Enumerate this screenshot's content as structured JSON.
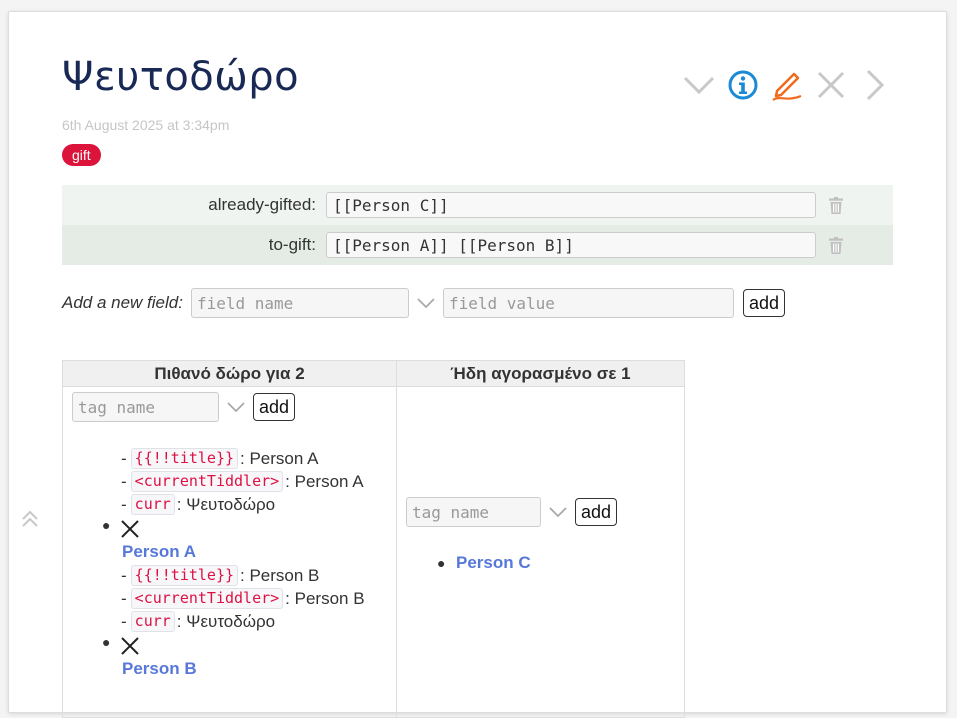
{
  "tiddler": {
    "title": "Ψευτοδώρο",
    "subtitle": "6th August 2025 at 3:34pm",
    "tag": "gift"
  },
  "toolbar": {
    "icons": [
      "chevron-down-icon",
      "info-icon",
      "edit-icon",
      "close-icon",
      "chevron-right-icon"
    ],
    "colors": {
      "muted": "#c8c8c8",
      "info": "#1b8ad6",
      "edit": "#f06b1d"
    }
  },
  "fields": [
    {
      "name": "already-gifted:",
      "value": "[[Person C]]"
    },
    {
      "name": "to-gift:",
      "value": "[[Person A]] [[Person B]]"
    }
  ],
  "new_field": {
    "label": "Add a new field:",
    "name_placeholder": "field name",
    "value_placeholder": "field value",
    "add_label": "add"
  },
  "table": {
    "headers": [
      "Πιθανό δώρο για 2",
      "Ήδη αγορασμένο σε 1"
    ],
    "tag_placeholder": "tag name",
    "add_label": "add",
    "entries": [
      {
        "lines": [
          {
            "code": "{{!!title}}",
            "text": ": Person A"
          },
          {
            "code": "<currentTiddler>",
            "text": ": Person A"
          },
          {
            "code": "curr",
            "text": ": Ψευτοδώρο"
          }
        ],
        "link": "Person A"
      },
      {
        "lines": [
          {
            "code": "{{!!title}}",
            "text": ": Person B"
          },
          {
            "code": "<currentTiddler>",
            "text": ": Person B"
          },
          {
            "code": "curr",
            "text": ": Ψευτοδώρο"
          }
        ],
        "link": "Person B"
      }
    ],
    "gifted": [
      "Person C"
    ]
  }
}
